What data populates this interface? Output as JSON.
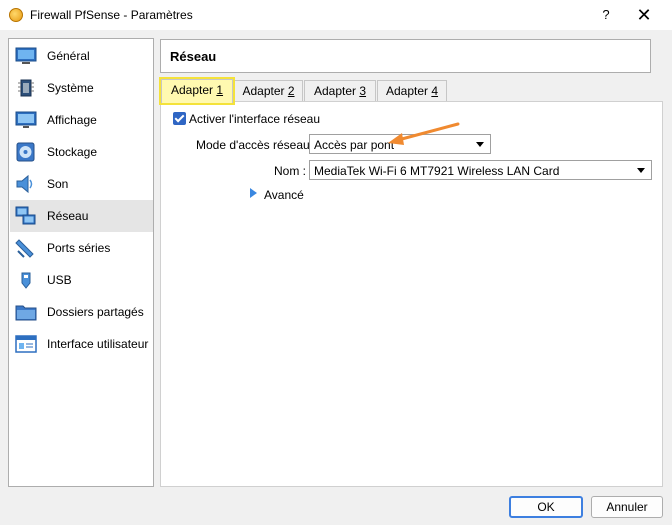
{
  "window": {
    "title": "Firewall PfSense - Paramètres",
    "help": "?",
    "close": "✕"
  },
  "sidebar": {
    "items": [
      {
        "label": "Général",
        "icon": "general-icon"
      },
      {
        "label": "Système",
        "icon": "system-icon"
      },
      {
        "label": "Affichage",
        "icon": "display-icon"
      },
      {
        "label": "Stockage",
        "icon": "storage-icon"
      },
      {
        "label": "Son",
        "icon": "audio-icon"
      },
      {
        "label": "Réseau",
        "icon": "network-icon",
        "selected": true
      },
      {
        "label": "Ports séries",
        "icon": "serial-ports-icon"
      },
      {
        "label": "USB",
        "icon": "usb-icon"
      },
      {
        "label": "Dossiers partagés",
        "icon": "shared-folders-icon"
      },
      {
        "label": "Interface utilisateur",
        "icon": "user-interface-icon"
      }
    ]
  },
  "section": {
    "title": "Réseau"
  },
  "tabs": [
    {
      "pre": "Adapter ",
      "key": "1",
      "active": true
    },
    {
      "pre": "Adapter ",
      "key": "2"
    },
    {
      "pre": "Adapter ",
      "key": "3"
    },
    {
      "pre": "Adapter ",
      "key": "4"
    }
  ],
  "adapter": {
    "enable_label": "Activer l'interface réseau",
    "mode_label": "Mode d'accès réseau :",
    "mode_value": "Accès par pont",
    "name_label": "Nom :",
    "name_value": "MediaTek Wi-Fi 6 MT7921 Wireless LAN Card",
    "advanced_label": "Avancé"
  },
  "buttons": {
    "ok": "OK",
    "cancel": "Annuler"
  },
  "colors": {
    "accent": "#3d7fe0",
    "highlight": "#f4e23a",
    "annotation_arrow": "#f08a30"
  }
}
